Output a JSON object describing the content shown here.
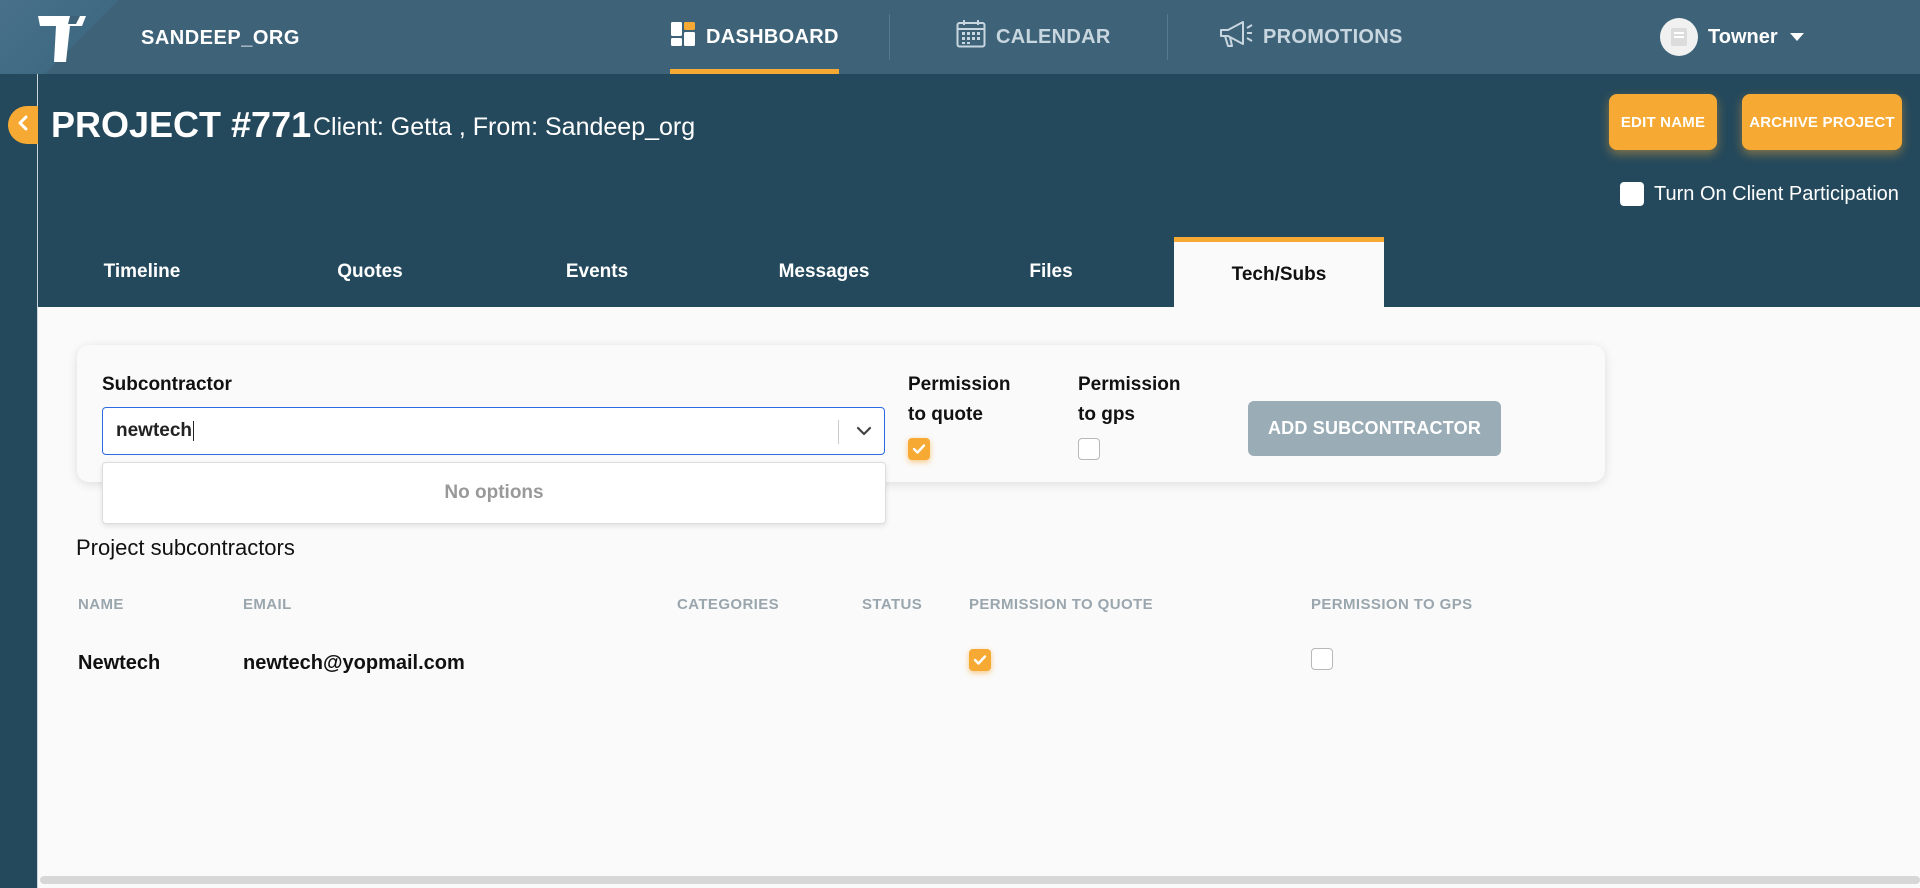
{
  "app": {
    "org_name": "SANDEEP_ORG",
    "nav": [
      {
        "label": "DASHBOARD",
        "icon": "dashboard-icon",
        "active": true
      },
      {
        "label": "CALENDAR",
        "icon": "calendar-icon",
        "active": false
      },
      {
        "label": "PROMOTIONS",
        "icon": "megaphone-icon",
        "active": false
      }
    ],
    "user": {
      "name": "Towner"
    }
  },
  "project": {
    "title": "PROJECT #771",
    "subtitle": "Client: Getta , From: Sandeep_org",
    "edit_name_label": "EDIT NAME",
    "archive_label": "ARCHIVE PROJECT",
    "client_participation_label": "Turn On Client Participation"
  },
  "tabs": [
    {
      "label": "Timeline",
      "active": false
    },
    {
      "label": "Quotes",
      "active": false
    },
    {
      "label": "Events",
      "active": false
    },
    {
      "label": "Messages",
      "active": false
    },
    {
      "label": "Files",
      "active": false
    },
    {
      "label": "Tech/Subs",
      "active": true
    }
  ],
  "form": {
    "subcontractor_label": "Subcontractor",
    "subcontractor_value": "newtech",
    "dropdown_empty": "No options",
    "perm_quote_label_1": "Permission",
    "perm_quote_label_2": "to quote",
    "perm_quote_checked": true,
    "perm_gps_label_1": "Permission",
    "perm_gps_label_2": "to gps",
    "perm_gps_checked": false,
    "add_button": "ADD SUBCONTRACTOR"
  },
  "subcontractors": {
    "title": "Project subcontractors",
    "columns": [
      "NAME",
      "EMAIL",
      "CATEGORIES",
      "STATUS",
      "PERMISSION TO QUOTE",
      "PERMISSION TO GPS"
    ],
    "rows": [
      {
        "name": "Newtech",
        "email": "newtech@yopmail.com",
        "categories": "",
        "status": "",
        "perm_quote": true,
        "perm_gps": false
      }
    ]
  },
  "colors": {
    "nav_bg": "#3e6379",
    "header_bg": "#24495c",
    "accent": "#f6a933",
    "disabled_button": "#9aacb6"
  }
}
